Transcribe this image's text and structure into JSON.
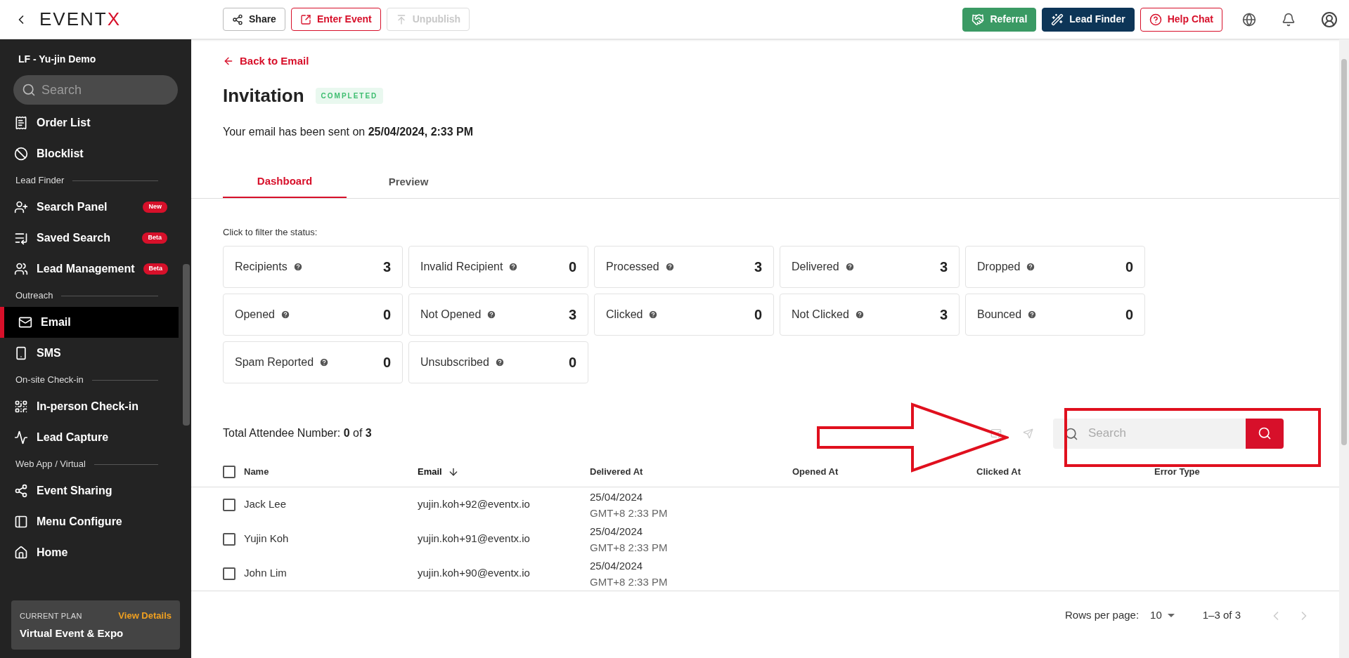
{
  "topbar": {
    "logo": {
      "text": "EVENT",
      "accent": "X"
    },
    "actions": [
      {
        "label": "Share",
        "kind": "share",
        "disabled": false
      },
      {
        "label": "Enter Event",
        "kind": "enter",
        "disabled": false
      },
      {
        "label": "Unpublish",
        "kind": "unpublish",
        "disabled": true
      }
    ],
    "promos": [
      {
        "label": "Referral",
        "kind": "referral"
      },
      {
        "label": "Lead Finder",
        "kind": "leadfinder"
      },
      {
        "label": "Help Chat",
        "kind": "help"
      }
    ]
  },
  "sidebar": {
    "org": "LF - Yu-jin Demo",
    "search": {
      "placeholder": "Search"
    },
    "items": [
      {
        "kind": "item",
        "label": "Order List",
        "selected": false
      },
      {
        "kind": "item",
        "label": "Blocklist",
        "selected": false
      },
      {
        "kind": "section",
        "label": "Lead Finder"
      },
      {
        "kind": "item",
        "label": "Search Panel",
        "badge": "New",
        "selected": false
      },
      {
        "kind": "item",
        "label": "Saved Search",
        "badge": "Beta",
        "selected": false
      },
      {
        "kind": "item",
        "label": "Lead Management",
        "badge": "Beta",
        "selected": false
      },
      {
        "kind": "section",
        "label": "Outreach"
      },
      {
        "kind": "item",
        "label": "Email",
        "selected": true
      },
      {
        "kind": "item",
        "label": "SMS",
        "selected": false
      },
      {
        "kind": "section",
        "label": "On-site Check-in"
      },
      {
        "kind": "item",
        "label": "In-person Check-in",
        "selected": false
      },
      {
        "kind": "item",
        "label": "Lead Capture",
        "selected": false
      },
      {
        "kind": "section",
        "label": "Web App / Virtual"
      },
      {
        "kind": "item",
        "label": "Event Sharing",
        "selected": false
      },
      {
        "kind": "item",
        "label": "Menu Configure",
        "selected": false
      },
      {
        "kind": "item",
        "label": "Home",
        "selected": false
      }
    ],
    "plan": {
      "caption": "CURRENT PLAN",
      "link": "View Details",
      "name": "Virtual Event & Expo"
    }
  },
  "main": {
    "back": "Back to Email",
    "title": "Invitation",
    "status": "COMPLETED",
    "sent": "Your email has been sent on **25/04/2024, 2:33 PM**",
    "tabs": [
      {
        "label": "Dashboard",
        "selected": true
      },
      {
        "label": "Preview",
        "selected": false
      }
    ],
    "filter_label": "Click to filter the status:",
    "stats": [
      {
        "label": "Recipients",
        "value": "3"
      },
      {
        "label": "Invalid Recipient",
        "value": "0"
      },
      {
        "label": "Processed",
        "value": "3"
      },
      {
        "label": "Delivered",
        "value": "3"
      },
      {
        "label": "Dropped",
        "value": "0"
      },
      {
        "label": "Opened",
        "value": "0"
      },
      {
        "label": "Not Opened",
        "value": "3"
      },
      {
        "label": "Clicked",
        "value": "0"
      },
      {
        "label": "Not Clicked",
        "value": "3"
      },
      {
        "label": "Bounced",
        "value": "0"
      },
      {
        "label": "Spam Reported",
        "value": "0"
      },
      {
        "label": "Unsubscribed",
        "value": "0"
      }
    ],
    "total": "Total Attendee Number: **0** of **3**",
    "search": {
      "placeholder": "Search"
    },
    "table": {
      "select_all": false,
      "columns": [
        {
          "label": "Name",
          "sorted": false
        },
        {
          "label": "Email",
          "sorted": true
        },
        {
          "label": "Delivered At",
          "sorted": false
        },
        {
          "label": "Opened At",
          "sorted": false
        },
        {
          "label": "Clicked At",
          "sorted": false
        },
        {
          "label": "Error Type",
          "sorted": false
        }
      ],
      "rows": [
        {
          "checked": false,
          "name": "Jack Lee",
          "email": "yujin.koh+92@eventx.io",
          "delivered": [
            "25/04/2024",
            "GMT+8 2:33 PM"
          ]
        },
        {
          "checked": false,
          "name": "Yujin Koh",
          "email": "yujin.koh+91@eventx.io",
          "delivered": [
            "25/04/2024",
            "GMT+8 2:33 PM"
          ]
        },
        {
          "checked": false,
          "name": "John Lim",
          "email": "yujin.koh+90@eventx.io",
          "delivered": [
            "25/04/2024",
            "GMT+8 2:33 PM"
          ]
        }
      ]
    },
    "pagination": {
      "label": "Rows per page:",
      "rows_per_page": "10",
      "range": "1–3 of 3"
    }
  },
  "annotation": {
    "arrow": true,
    "highlight_box": true
  }
}
